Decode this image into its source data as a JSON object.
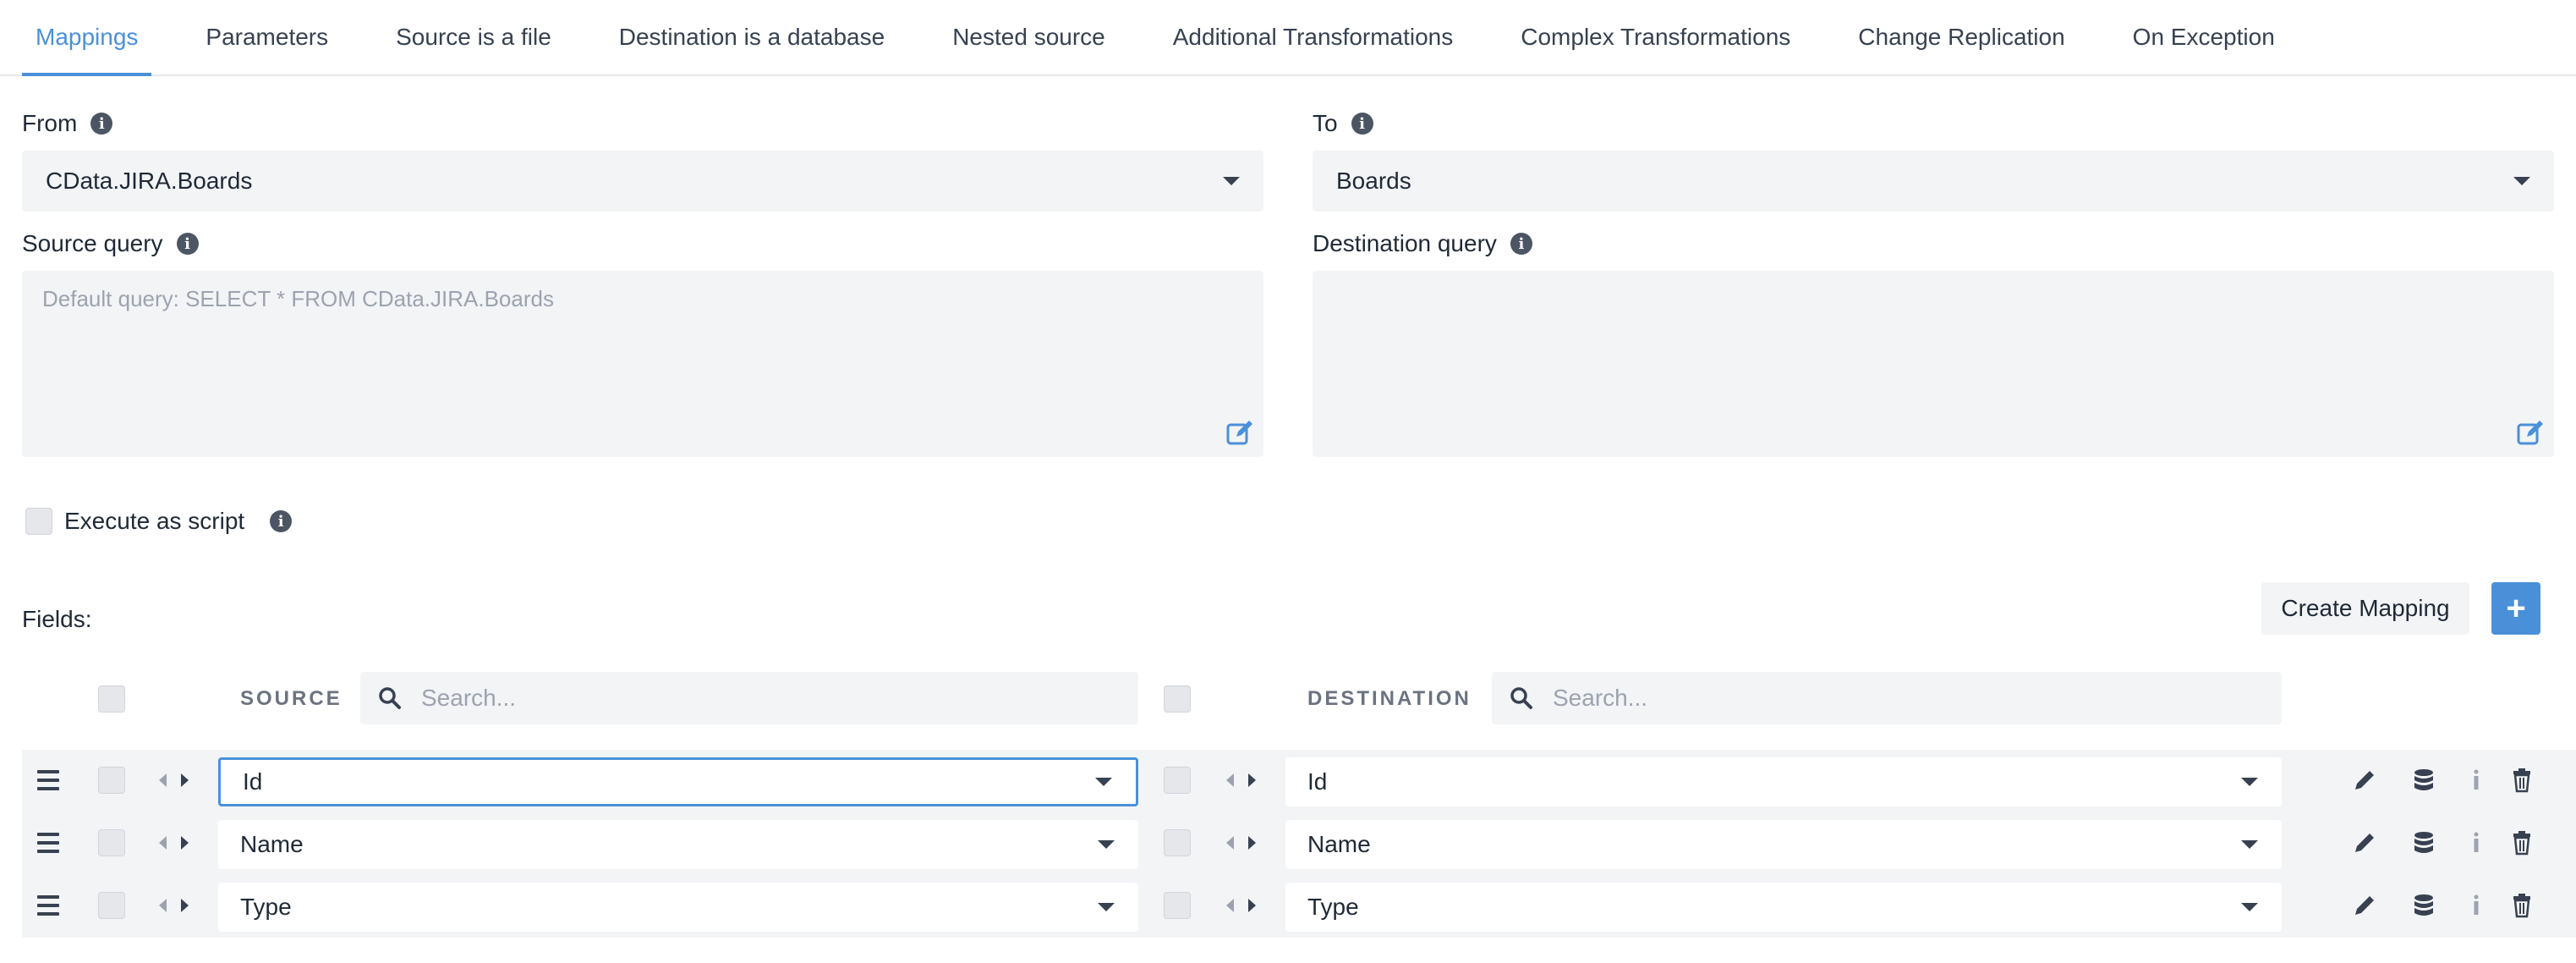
{
  "tabs": [
    {
      "label": "Mappings",
      "active": true
    },
    {
      "label": "Parameters"
    },
    {
      "label": "Source is a file"
    },
    {
      "label": "Destination is a database"
    },
    {
      "label": "Nested source"
    },
    {
      "label": "Additional Transformations"
    },
    {
      "label": "Complex Transformations"
    },
    {
      "label": "Change Replication"
    },
    {
      "label": "On Exception"
    }
  ],
  "from": {
    "label": "From",
    "value": "CData.JIRA.Boards"
  },
  "to": {
    "label": "To",
    "value": "Boards"
  },
  "source_query": {
    "label": "Source query",
    "placeholder": "Default query: SELECT * FROM CData.JIRA.Boards"
  },
  "destination_query": {
    "label": "Destination query",
    "placeholder": ""
  },
  "execute_as_script": {
    "label": "Execute as script",
    "checked": false
  },
  "fields": {
    "label": "Fields:",
    "create_mapping_label": "Create Mapping",
    "add_label": "+",
    "source_header": "SOURCE",
    "destination_header": "DESTINATION",
    "search_placeholder": "Search..."
  },
  "rows": [
    {
      "source": "Id",
      "destination": "Id"
    },
    {
      "source": "Name",
      "destination": "Name"
    },
    {
      "source": "Type",
      "destination": "Type"
    }
  ],
  "colors": {
    "accent": "#4a90d9",
    "field_bg": "#f3f4f6"
  }
}
